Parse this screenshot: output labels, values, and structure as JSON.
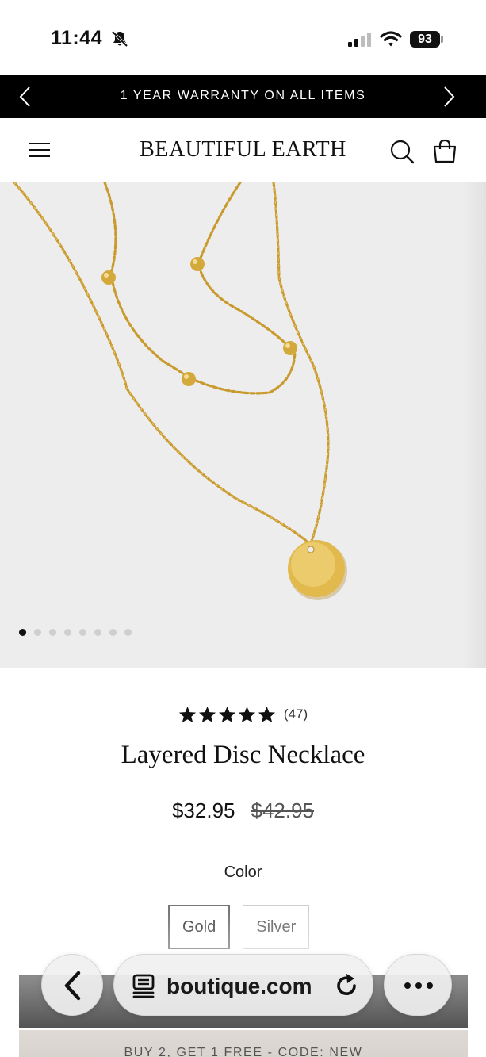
{
  "status_bar": {
    "time": "11:44",
    "battery": "93",
    "icons": [
      "bell-slash-icon",
      "signal-icon",
      "wifi-icon",
      "battery-icon"
    ]
  },
  "announcement": {
    "text": "1 YEAR WARRANTY ON ALL ITEMS",
    "prev_icon": "chevron-left-icon",
    "next_icon": "chevron-right-icon"
  },
  "header": {
    "logo": "BEAUTIFUL EARTH",
    "icons": [
      "menu-icon",
      "search-icon",
      "shopping-bag-icon"
    ]
  },
  "gallery": {
    "image": "gold-layered-disc-necklace-photo",
    "slide_count": 8,
    "active_slide": 1
  },
  "product": {
    "rating": 5,
    "review_count": "(47)",
    "title": "Layered Disc Necklace",
    "price": "$32.95",
    "compare_price": "$42.95",
    "color_label": "Color",
    "colors": [
      {
        "label": "Gold",
        "selected": true
      },
      {
        "label": "Silver",
        "selected": false
      }
    ]
  },
  "promo": {
    "text": "BUY 2, GET 1 FREE - CODE: NEW"
  },
  "browser_toolbar": {
    "url": "boutique.com",
    "icons": [
      "back-arrow-icon",
      "tabs-icon",
      "reload-icon",
      "more-icon"
    ]
  },
  "colors": {
    "announcement_bg": "#000000",
    "gallery_bg": "#ededed",
    "promo_bg": "#cfc8c2",
    "gold": "#d4a93c"
  }
}
